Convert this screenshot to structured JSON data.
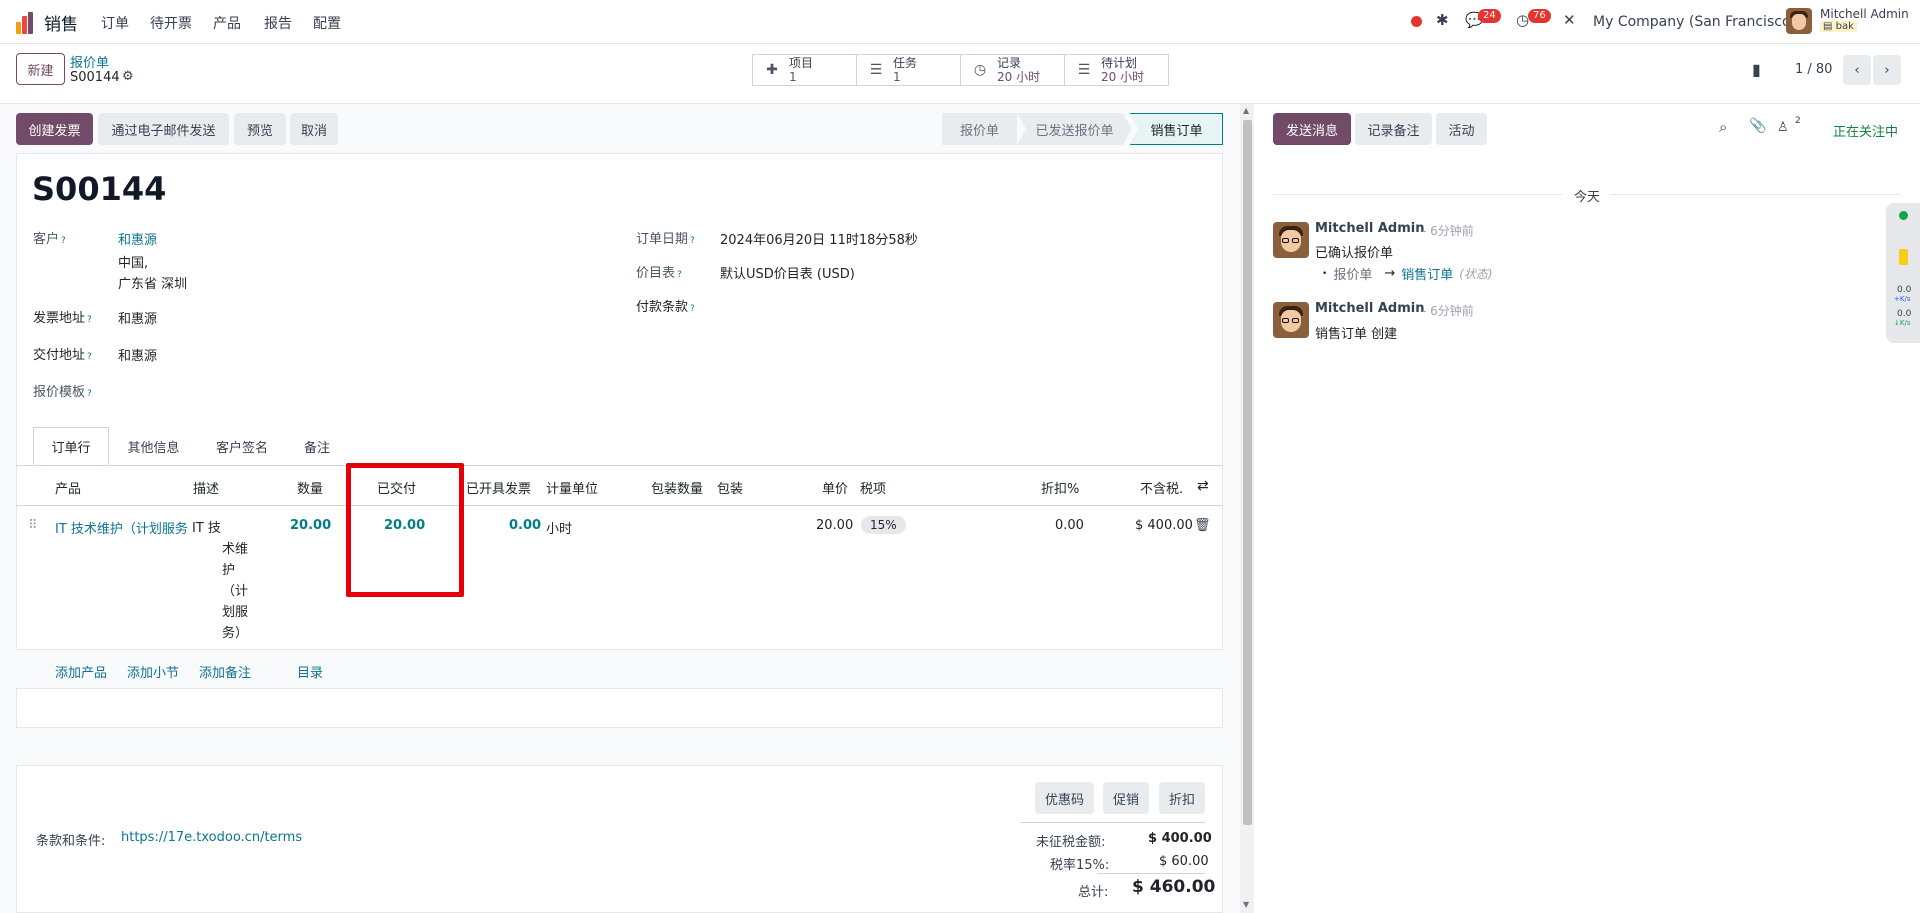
{
  "navbar": {
    "app_name": "销售",
    "menu": [
      "订单",
      "待开票",
      "产品",
      "报告",
      "配置"
    ],
    "messages_count": "24",
    "activities_count": "76",
    "company": "My Company (San Francisco)",
    "user_name": "Mitchell Admin",
    "user_db": "bak"
  },
  "control_panel": {
    "new_label": "新建",
    "breadcrumb_parent": "报价单",
    "record_name": "S00144",
    "pager": "1 / 80"
  },
  "smart_buttons": [
    {
      "label": "项目",
      "value": "1",
      "icon": "puzzle-icon"
    },
    {
      "label": "任务",
      "value": "1",
      "icon": "tasks-icon"
    },
    {
      "label": "记录",
      "value": "20 小时",
      "icon": "clock-icon"
    },
    {
      "label": "待计划",
      "value": "20 小时",
      "icon": "planning-icon"
    }
  ],
  "actions": {
    "create_invoice": "创建发票",
    "send_email": "通过电子邮件发送",
    "preview": "预览",
    "cancel": "取消"
  },
  "statusbar": [
    "报价单",
    "已发送报价单",
    "销售订单"
  ],
  "form": {
    "title": "S00144",
    "customer_label": "客户",
    "customer_name": "和惠源",
    "customer_addr1": "中国,",
    "customer_addr2": "广东省 深圳",
    "invoice_addr_label": "发票地址",
    "invoice_addr": "和惠源",
    "delivery_addr_label": "交付地址",
    "delivery_addr": "和惠源",
    "quote_template_label": "报价模板",
    "order_date_label": "订单日期",
    "order_date": "2024年06月20日 11时18分58秒",
    "pricelist_label": "价目表",
    "pricelist": "默认USD价目表 (USD)",
    "payment_terms_label": "付款条款",
    "tabs": [
      "订单行",
      "其他信息",
      "客户签名",
      "备注"
    ],
    "columns": {
      "product": "产品",
      "description": "描述",
      "quantity": "数量",
      "delivered": "已交付",
      "invoiced": "已开具发票",
      "uom": "计量单位",
      "pkg_qty": "包装数量",
      "packaging": "包装",
      "unit_price": "单价",
      "taxes": "税项",
      "discount": "折扣%",
      "subtotal": "不含税."
    },
    "line": {
      "product": "IT 技术维护（计划服务",
      "description": [
        "IT 技",
        "术维",
        "护",
        "（计",
        "划服",
        "务）"
      ],
      "quantity": "20.00",
      "delivered": "20.00",
      "invoiced": "0.00",
      "uom": "小时",
      "unit_price": "20.00",
      "tax": "15%",
      "discount": "0.00",
      "subtotal": "$ 400.00"
    },
    "add_links": [
      "添加产品",
      "添加小节",
      "添加备注",
      "目录"
    ],
    "discount_buttons": [
      "优惠码",
      "促销",
      "折扣"
    ],
    "terms_label": "条款和条件:",
    "terms_url": "https://17e.txodoo.cn/terms",
    "totals": {
      "untaxed_label": "未征税金额:",
      "untaxed": "$ 400.00",
      "tax_label": "税率15%:",
      "tax": "$ 60.00",
      "total_label": "总计:",
      "total": "$ 460.00"
    }
  },
  "chatter": {
    "send_message": "发送消息",
    "log_note": "记录备注",
    "activity": "活动",
    "followers_count": "2",
    "following": "正在关注中",
    "date_sep": "今天",
    "messages": [
      {
        "author": "Mitchell Admin",
        "time": "- 6分钟前",
        "body": "已确认报价单",
        "change_from": "报价单",
        "change_arrow": "→",
        "change_to": "销售订单",
        "change_field": "(状态)"
      },
      {
        "author": "Mitchell Admin",
        "time": "- 6分钟前",
        "body": "销售订单 创建"
      }
    ]
  },
  "widget": {
    "up": "0.0",
    "up_unit": "K/s",
    "down": "0.0",
    "down_unit": "K/s"
  },
  "colors": {
    "brand": "#714b67",
    "link": "#0e7490",
    "highlight_box": "#e3000b"
  }
}
